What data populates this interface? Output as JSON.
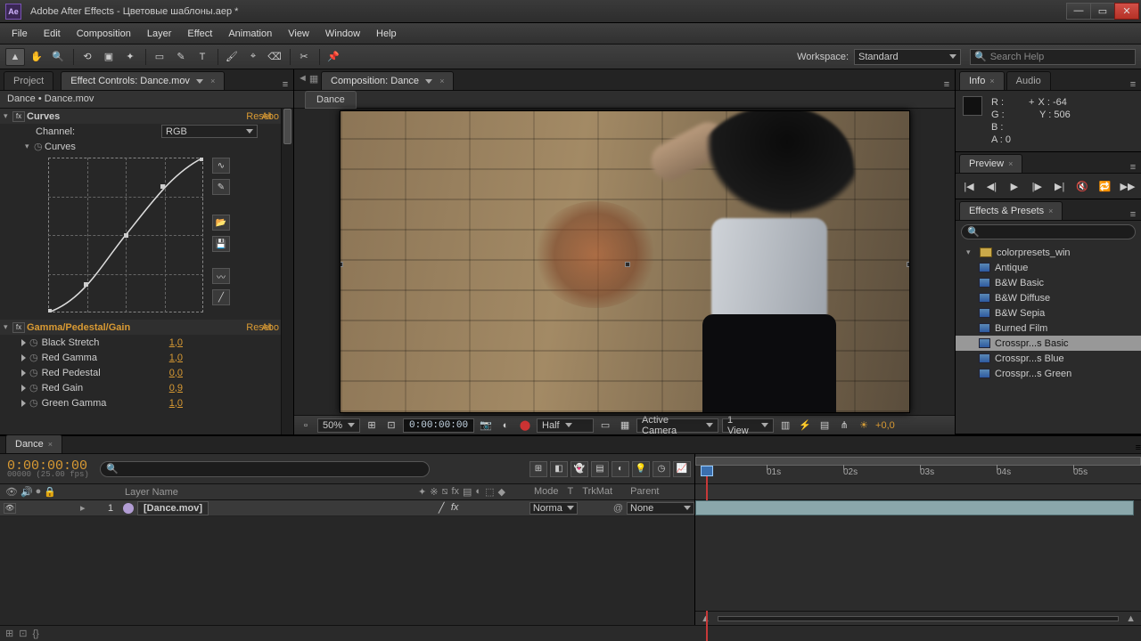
{
  "window": {
    "title": "Adobe After Effects - Цветовые шаблоны.aep *",
    "app_icon": "Ae"
  },
  "menu": [
    "File",
    "Edit",
    "Composition",
    "Layer",
    "Effect",
    "Animation",
    "View",
    "Window",
    "Help"
  ],
  "workspace": {
    "label": "Workspace:",
    "value": "Standard"
  },
  "search_help": {
    "placeholder": "Search Help"
  },
  "left_tabs": {
    "project": "Project",
    "ec": "Effect Controls: Dance.mov"
  },
  "ec_header": "Dance • Dance.mov",
  "fx_curves": {
    "name": "Curves",
    "reset": "Reset",
    "about": "Abo",
    "channel_label": "Channel:",
    "channel_value": "RGB",
    "sub": "Curves"
  },
  "fx_gpg": {
    "name": "Gamma/Pedestal/Gain",
    "reset": "Reset",
    "about": "Abo",
    "props": [
      {
        "label": "Black Stretch",
        "value": "1,0"
      },
      {
        "label": "Red Gamma",
        "value": "1,0"
      },
      {
        "label": "Red Pedestal",
        "value": "0,0"
      },
      {
        "label": "Red Gain",
        "value": "0,9"
      },
      {
        "label": "Green Gamma",
        "value": "1,0"
      }
    ]
  },
  "comp_tab": "Composition: Dance",
  "comp_name": "Dance",
  "viewer_footer": {
    "zoom": "50%",
    "timecode": "0:00:00:00",
    "resolution": "Half",
    "camera": "Active Camera",
    "views": "1 View",
    "exposure": "+0,0"
  },
  "info": {
    "tab_info": "Info",
    "tab_audio": "Audio",
    "r": "R :",
    "g": "G :",
    "b": "B :",
    "a": "A : 0",
    "x": "X : -64",
    "y": "Y : 506"
  },
  "preview": {
    "tab": "Preview"
  },
  "ep": {
    "tab": "Effects & Presets",
    "folder": "colorpresets_win",
    "items": [
      "Antique",
      "B&W Basic",
      "B&W Diffuse",
      "B&W Sepia",
      "Burned Film",
      "Crosspr...s Basic",
      "Crosspr...s Blue",
      "Crosspr...s Green"
    ],
    "selected_index": 5
  },
  "timeline": {
    "tab": "Dance",
    "current_time": "0:00:00:00",
    "subtime": "00000 (25.00 fps)",
    "col_layer": "Layer Name",
    "col_mode": "Mode",
    "col_t": "T",
    "col_trkmat": "TrkMat",
    "col_parent": "Parent",
    "layer": {
      "num": "1",
      "name": "[Dance.mov]",
      "mode": "Norma",
      "parent": "None"
    },
    "ticks": [
      "01s",
      "02s",
      "03s",
      "04s",
      "05s"
    ]
  }
}
